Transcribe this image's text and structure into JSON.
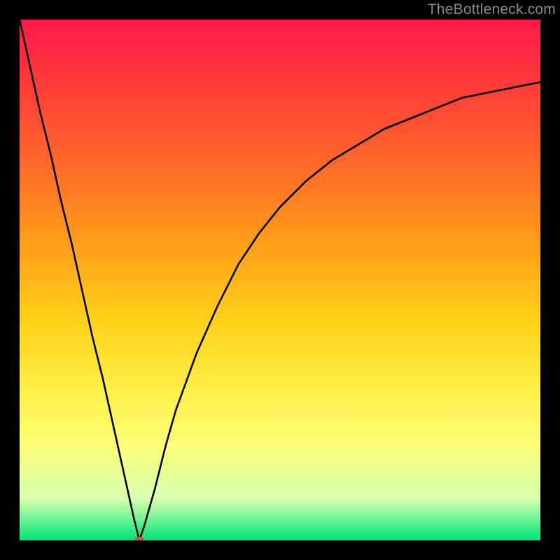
{
  "watermark": {
    "text": "TheBottleneck.com"
  },
  "colors": {
    "frame": "#000000",
    "gradient_stops": [
      "#ff1a4b",
      "#ff3a3a",
      "#ff6a2a",
      "#ff9a1a",
      "#ffd21a",
      "#fff04a",
      "#fdff7a",
      "#d8ffb0",
      "#00e676"
    ],
    "curve": "#000000",
    "marker": "#c7564c"
  },
  "chart_data": {
    "type": "line",
    "title": "",
    "xlabel": "",
    "ylabel": "",
    "xlim": [
      0,
      100
    ],
    "ylim": [
      0,
      100
    ],
    "x": [
      0,
      2,
      4,
      6,
      8,
      10,
      12,
      14,
      16,
      18,
      20,
      22,
      23,
      24,
      26,
      28,
      30,
      34,
      38,
      42,
      46,
      50,
      55,
      60,
      65,
      70,
      75,
      80,
      85,
      90,
      95,
      100
    ],
    "values": [
      100,
      91,
      82,
      74,
      65,
      57,
      48,
      39,
      31,
      22,
      13,
      4,
      0,
      3,
      10,
      18,
      25,
      36,
      45,
      53,
      59,
      64,
      69,
      73,
      76,
      79,
      81,
      83,
      85,
      86,
      87,
      88
    ],
    "marker": {
      "x": 23,
      "y": 0
    },
    "legend": [],
    "grid": false
  }
}
